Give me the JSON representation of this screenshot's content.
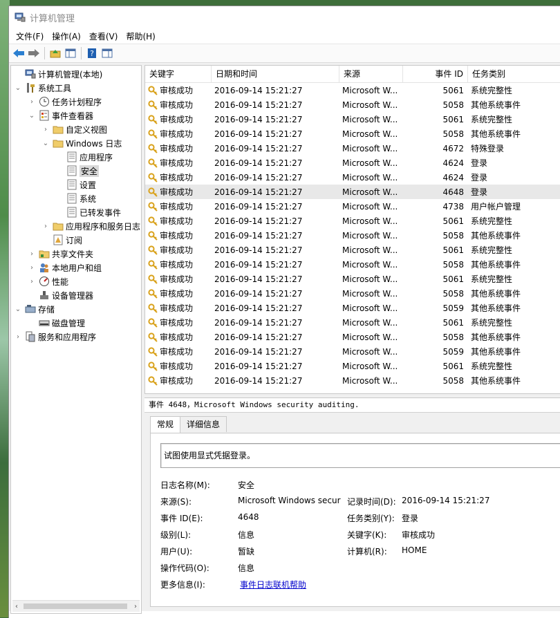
{
  "window": {
    "title": "计算机管理"
  },
  "menu": [
    "文件(F)",
    "操作(A)",
    "查看(V)",
    "帮助(H)"
  ],
  "tree": [
    {
      "label": "计算机管理(本地)",
      "toggle": "",
      "icon": "computer-icon"
    },
    {
      "label": "系统工具",
      "toggle": "⌄",
      "icon": "tools-icon"
    },
    {
      "label": "任务计划程序",
      "toggle": "›",
      "icon": "clock-icon"
    },
    {
      "label": "事件查看器",
      "toggle": "⌄",
      "icon": "event-viewer-icon"
    },
    {
      "label": "自定义视图",
      "toggle": "›",
      "icon": "folder-icon"
    },
    {
      "label": "Windows 日志",
      "toggle": "⌄",
      "icon": "folder-icon"
    },
    {
      "label": "应用程序",
      "toggle": "",
      "icon": "log-icon"
    },
    {
      "label": "安全",
      "toggle": "",
      "icon": "log-icon"
    },
    {
      "label": "设置",
      "toggle": "",
      "icon": "log-icon"
    },
    {
      "label": "系统",
      "toggle": "",
      "icon": "log-icon"
    },
    {
      "label": "已转发事件",
      "toggle": "",
      "icon": "log-icon"
    },
    {
      "label": "应用程序和服务日志",
      "toggle": "›",
      "icon": "folder-icon"
    },
    {
      "label": "订阅",
      "toggle": "",
      "icon": "subscription-icon"
    },
    {
      "label": "共享文件夹",
      "toggle": "›",
      "icon": "shared-folder-icon"
    },
    {
      "label": "本地用户和组",
      "toggle": "›",
      "icon": "users-icon"
    },
    {
      "label": "性能",
      "toggle": "›",
      "icon": "performance-icon"
    },
    {
      "label": "设备管理器",
      "toggle": "",
      "icon": "device-manager-icon"
    },
    {
      "label": "存储",
      "toggle": "⌄",
      "icon": "storage-icon"
    },
    {
      "label": "磁盘管理",
      "toggle": "",
      "icon": "disk-icon"
    },
    {
      "label": "服务和应用程序",
      "toggle": "›",
      "icon": "services-icon"
    }
  ],
  "columns": [
    "关键字",
    "日期和时间",
    "来源",
    "事件 ID",
    "任务类别"
  ],
  "events": [
    {
      "keyword": "审核成功",
      "datetime": "2016-09-14 15:21:27",
      "source": "Microsoft W...",
      "id": "5061",
      "category": "系统完整性"
    },
    {
      "keyword": "审核成功",
      "datetime": "2016-09-14 15:21:27",
      "source": "Microsoft W...",
      "id": "5058",
      "category": "其他系统事件"
    },
    {
      "keyword": "审核成功",
      "datetime": "2016-09-14 15:21:27",
      "source": "Microsoft W...",
      "id": "5061",
      "category": "系统完整性"
    },
    {
      "keyword": "审核成功",
      "datetime": "2016-09-14 15:21:27",
      "source": "Microsoft W...",
      "id": "5058",
      "category": "其他系统事件"
    },
    {
      "keyword": "审核成功",
      "datetime": "2016-09-14 15:21:27",
      "source": "Microsoft W...",
      "id": "4672",
      "category": "特殊登录"
    },
    {
      "keyword": "审核成功",
      "datetime": "2016-09-14 15:21:27",
      "source": "Microsoft W...",
      "id": "4624",
      "category": "登录"
    },
    {
      "keyword": "审核成功",
      "datetime": "2016-09-14 15:21:27",
      "source": "Microsoft W...",
      "id": "4624",
      "category": "登录"
    },
    {
      "keyword": "审核成功",
      "datetime": "2016-09-14 15:21:27",
      "source": "Microsoft W...",
      "id": "4648",
      "category": "登录"
    },
    {
      "keyword": "审核成功",
      "datetime": "2016-09-14 15:21:27",
      "source": "Microsoft W...",
      "id": "4738",
      "category": "用户帐户管理"
    },
    {
      "keyword": "审核成功",
      "datetime": "2016-09-14 15:21:27",
      "source": "Microsoft W...",
      "id": "5061",
      "category": "系统完整性"
    },
    {
      "keyword": "审核成功",
      "datetime": "2016-09-14 15:21:27",
      "source": "Microsoft W...",
      "id": "5058",
      "category": "其他系统事件"
    },
    {
      "keyword": "审核成功",
      "datetime": "2016-09-14 15:21:27",
      "source": "Microsoft W...",
      "id": "5061",
      "category": "系统完整性"
    },
    {
      "keyword": "审核成功",
      "datetime": "2016-09-14 15:21:27",
      "source": "Microsoft W...",
      "id": "5058",
      "category": "其他系统事件"
    },
    {
      "keyword": "审核成功",
      "datetime": "2016-09-14 15:21:27",
      "source": "Microsoft W...",
      "id": "5061",
      "category": "系统完整性"
    },
    {
      "keyword": "审核成功",
      "datetime": "2016-09-14 15:21:27",
      "source": "Microsoft W...",
      "id": "5058",
      "category": "其他系统事件"
    },
    {
      "keyword": "审核成功",
      "datetime": "2016-09-14 15:21:27",
      "source": "Microsoft W...",
      "id": "5059",
      "category": "其他系统事件"
    },
    {
      "keyword": "审核成功",
      "datetime": "2016-09-14 15:21:27",
      "source": "Microsoft W...",
      "id": "5061",
      "category": "系统完整性"
    },
    {
      "keyword": "审核成功",
      "datetime": "2016-09-14 15:21:27",
      "source": "Microsoft W...",
      "id": "5058",
      "category": "其他系统事件"
    },
    {
      "keyword": "审核成功",
      "datetime": "2016-09-14 15:21:27",
      "source": "Microsoft W...",
      "id": "5059",
      "category": "其他系统事件"
    },
    {
      "keyword": "审核成功",
      "datetime": "2016-09-14 15:21:27",
      "source": "Microsoft W...",
      "id": "5061",
      "category": "系统完整性"
    },
    {
      "keyword": "审核成功",
      "datetime": "2016-09-14 15:21:27",
      "source": "Microsoft W...",
      "id": "5058",
      "category": "其他系统事件"
    }
  ],
  "detail": {
    "title": "事件 4648，Microsoft Windows security auditing.",
    "tab_general": "常规",
    "tab_details": "详细信息",
    "description": "试图使用显式凭据登录。",
    "log_name_label": "日志名称(M):",
    "log_name": "安全",
    "source_label": "来源(S):",
    "source": "Microsoft Windows secur",
    "logged_label": "记录时间(D):",
    "logged": "2016-09-14 15:21:27",
    "event_id_label": "事件 ID(E):",
    "event_id": "4648",
    "task_label": "任务类别(Y):",
    "task": "登录",
    "level_label": "级别(L):",
    "level": "信息",
    "keywords_label": "关键字(K):",
    "keywords": "审核成功",
    "user_label": "用户(U):",
    "user": "暂缺",
    "computer_label": "计算机(R):",
    "computer": "HOME",
    "opcode_label": "操作代码(O):",
    "opcode": "信息",
    "more_label": "更多信息(I):",
    "more_link": "事件日志联机帮助"
  },
  "colors": {
    "link": "#0000cc",
    "selection": "#e8e8e8",
    "key_icon": "#d9a21c"
  }
}
